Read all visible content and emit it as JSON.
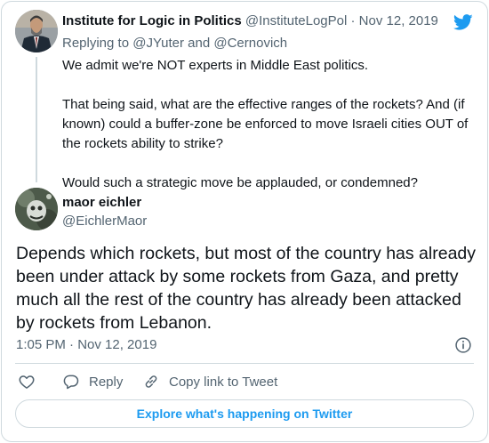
{
  "colors": {
    "text_primary": "#0f1419",
    "text_secondary": "#536471",
    "accent": "#1d9bf0",
    "border": "#cfd9de"
  },
  "quoted_tweet": {
    "display_name": "Institute for Logic in Politics",
    "handle": "@InstituteLogPol",
    "separator": "·",
    "date": "Nov 12, 2019",
    "reply_prefix": "Replying to",
    "reply_mention_1": "@JYuter",
    "reply_and": "and",
    "reply_mention_2": "@Cernovich",
    "paragraphs": [
      "We admit we're NOT experts in Middle East politics.",
      "That being said, what are the effective ranges of the rockets? And (if known) could a buffer-zone be enforced to move Israeli cities OUT of the rockets ability to strike?",
      "Would such a strategic move be applauded, or condemned?"
    ]
  },
  "main_tweet": {
    "display_name": "maor eichler",
    "handle": "@EichlerMaor",
    "text": "Depends which rockets, but most of the country has already been under attack by some rockets from Gaza, and pretty much all the rest of the country has already been attacked by rockets from Lebanon.",
    "timestamp": "1:05 PM · Nov 12, 2019"
  },
  "actions": {
    "reply_label": "Reply",
    "copy_label": "Copy link to Tweet"
  },
  "explore_label": "Explore what's happening on Twitter",
  "icons": [
    "twitter-bird-icon",
    "info-icon",
    "heart-icon",
    "reply-icon",
    "link-icon"
  ]
}
